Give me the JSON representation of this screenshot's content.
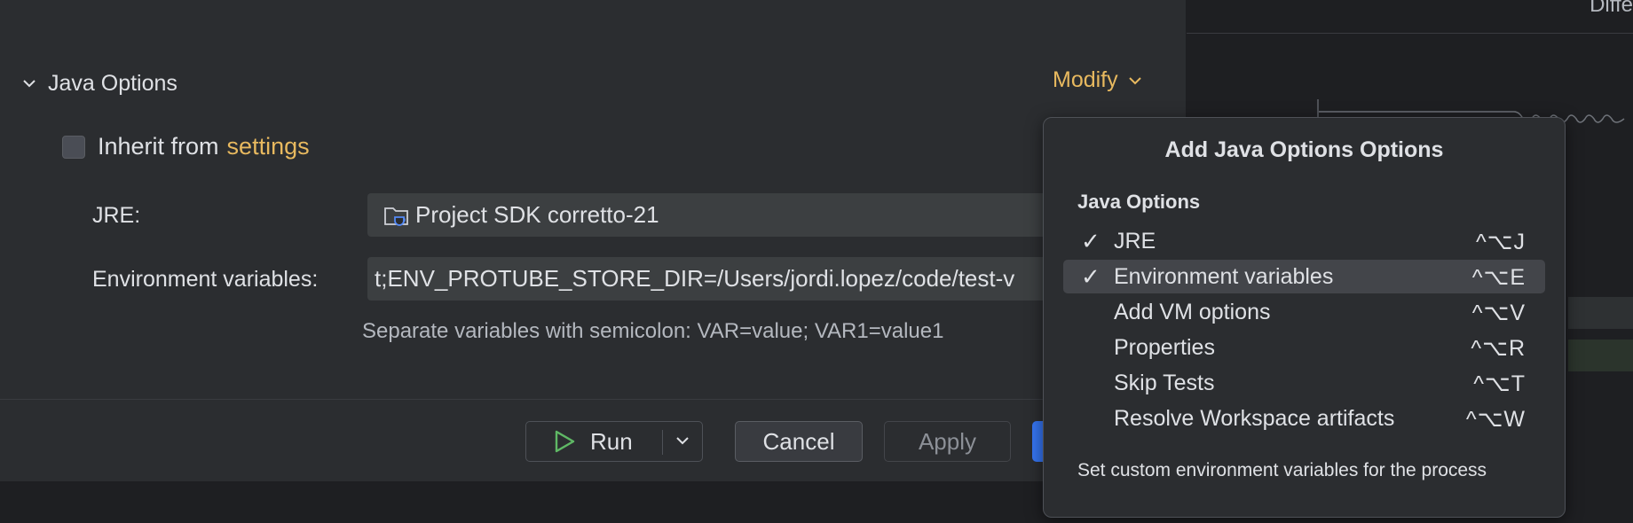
{
  "right_pane": {
    "header_partial": "Diffe"
  },
  "section": {
    "title": "Java Options",
    "modify_label": "Modify"
  },
  "inherit": {
    "label": "Inherit from",
    "link": "settings",
    "checked": false
  },
  "jre": {
    "label": "JRE:",
    "value": "Project SDK corretto-21"
  },
  "env": {
    "label": "Environment variables:",
    "value": "t;ENV_PROTUBE_STORE_DIR=/Users/jordi.lopez/code/test-v",
    "hint": "Separate variables with semicolon: VAR=value; VAR1=value1"
  },
  "buttons": {
    "run": "Run",
    "cancel": "Cancel",
    "apply": "Apply"
  },
  "popup": {
    "title": "Add Java Options Options",
    "group": "Java Options",
    "items": [
      {
        "label": "JRE",
        "shortcut": "^⌥J",
        "checked": true,
        "selected": false
      },
      {
        "label": "Environment variables",
        "shortcut": "^⌥E",
        "checked": true,
        "selected": true
      },
      {
        "label": "Add VM options",
        "shortcut": "^⌥V",
        "checked": false,
        "selected": false
      },
      {
        "label": "Properties",
        "shortcut": "^⌥R",
        "checked": false,
        "selected": false
      },
      {
        "label": "Skip Tests",
        "shortcut": "^⌥T",
        "checked": false,
        "selected": false
      },
      {
        "label": "Resolve Workspace artifacts",
        "shortcut": "^⌥W",
        "checked": false,
        "selected": false
      }
    ],
    "check_glyph": "✓",
    "description": "Set custom environment variables for the process"
  },
  "colors": {
    "accent": "#e8b95f",
    "primary": "#3574f0",
    "run_icon": "#5fb865"
  },
  "icons": [
    "chevron-down-icon",
    "folder-icon",
    "run-icon",
    "chevron-down-icon",
    "check-icon"
  ]
}
